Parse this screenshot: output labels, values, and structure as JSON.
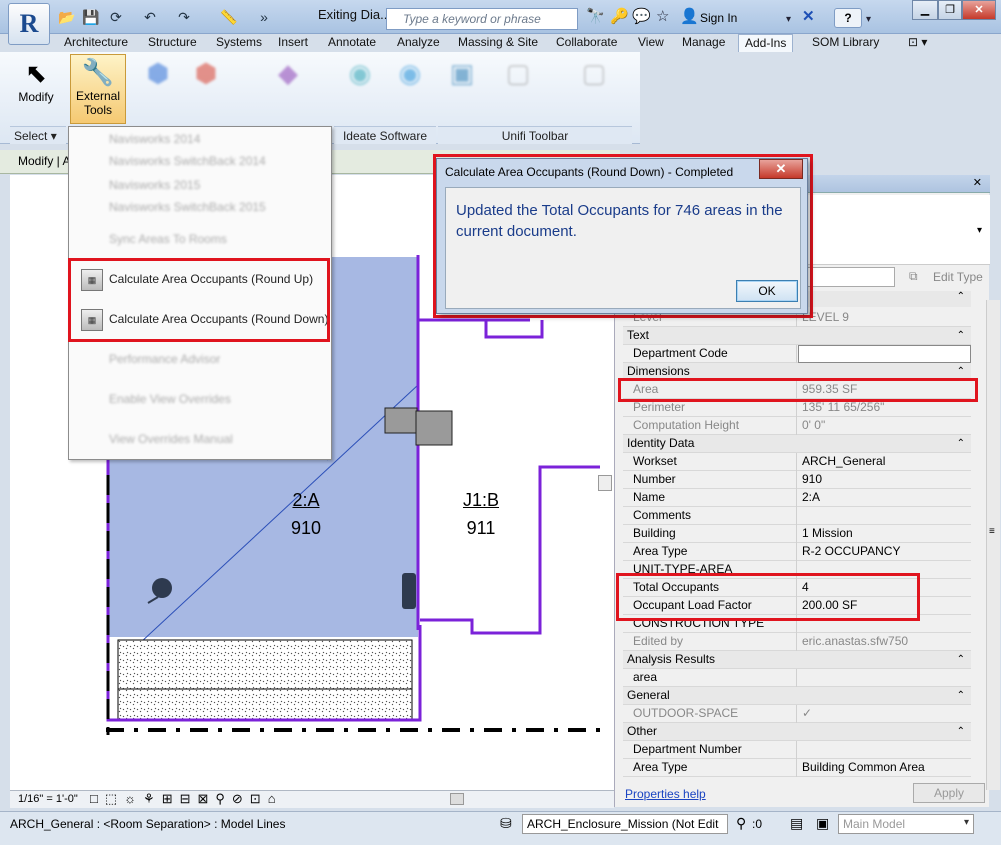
{
  "app": {
    "logo": "R",
    "doc_title": "Exiting Dia...",
    "search_placeholder": "Type a keyword or phrase",
    "sign_in": "Sign In",
    "help": "?"
  },
  "tabs": [
    "Architecture",
    "Structure",
    "Systems",
    "Insert",
    "Annotate",
    "Analyze",
    "Massing & Site",
    "Collaborate",
    "View",
    "Manage",
    "Add-Ins",
    "SOM Library"
  ],
  "active_tab": "Add-Ins",
  "ribbon": {
    "modify_label": "Modify",
    "external_tools_label": "External Tools",
    "select_label": "Select",
    "panel_ideate": "Ideate Software",
    "panel_unifi": "Unifi Toolbar"
  },
  "options_bar": {
    "modify_label": "Modify | A"
  },
  "menu": {
    "items_blurred": [
      "Navisworks 2014",
      "Navisworks SwitchBack 2014",
      "Navisworks 2015",
      "Navisworks SwitchBack 2015",
      "Sync Areas To Rooms"
    ],
    "item_round_up": "Calculate Area Occupants (Round Up)",
    "item_round_down": "Calculate Area Occupants (Round Down)",
    "items_blurred_after": [
      "Performance Advisor",
      "Enable View Overrides",
      "View Overrides Manual"
    ]
  },
  "dialog": {
    "title": "Calculate Area Occupants (Round Down) - Completed",
    "close": "✕",
    "message": "Updated the Total Occupants for 746 areas in the current document.",
    "ok": "OK"
  },
  "drawing": {
    "area1_name": "2:A",
    "area1_number": "910",
    "area2_name": "J1:B",
    "area2_number": "911",
    "area_fill": "#a7b8e3",
    "boundary_color": "#7b22d9"
  },
  "properties": {
    "edit_type": "Edit Type",
    "rows": [
      {
        "k": "Level",
        "v": "LEVEL 9",
        "ro": true
      },
      {
        "group": "Text"
      },
      {
        "k": "Department Code",
        "v": ""
      },
      {
        "group": "Dimensions"
      },
      {
        "k": "Area",
        "v": "959.35 SF",
        "ro": true
      },
      {
        "k": "Perimeter",
        "v": "135'  11 65/256\"",
        "ro": true
      },
      {
        "k": "Computation Height",
        "v": "0'  0\"",
        "ro": true
      },
      {
        "group": "Identity Data"
      },
      {
        "k": "Workset",
        "v": "ARCH_General"
      },
      {
        "k": "Number",
        "v": "910"
      },
      {
        "k": "Name",
        "v": "2:A"
      },
      {
        "k": "Comments",
        "v": ""
      },
      {
        "k": "Building",
        "v": "1 Mission"
      },
      {
        "k": "Area Type",
        "v": "R-2 OCCUPANCY"
      },
      {
        "k": "UNIT-TYPE-AREA",
        "v": ""
      },
      {
        "k": "Total Occupants",
        "v": "4"
      },
      {
        "k": "Occupant Load Factor",
        "v": "200.00 SF"
      },
      {
        "k": "CONSTRUCTION TYPE",
        "v": ""
      },
      {
        "k": "Edited by",
        "v": "eric.anastas.sfw750",
        "ro": true
      },
      {
        "group": "Analysis Results"
      },
      {
        "k": "area",
        "v": ""
      },
      {
        "group": "General"
      },
      {
        "k": "OUTDOOR-SPACE",
        "v": "✓",
        "ro": true
      },
      {
        "group": "Other"
      },
      {
        "k": "Department Number",
        "v": ""
      },
      {
        "k": "Area Type",
        "v": "Building Common Area"
      }
    ],
    "help_link": "Properties help",
    "apply": "Apply"
  },
  "view_bar": {
    "scale": "1/16\" = 1'-0\""
  },
  "status_bar": {
    "selection": "ARCH_General : <Room Separation> : Model Lines",
    "workset": "ARCH_Enclosure_Mission (Not Edit",
    "count": ":0",
    "model": "Main Model"
  }
}
